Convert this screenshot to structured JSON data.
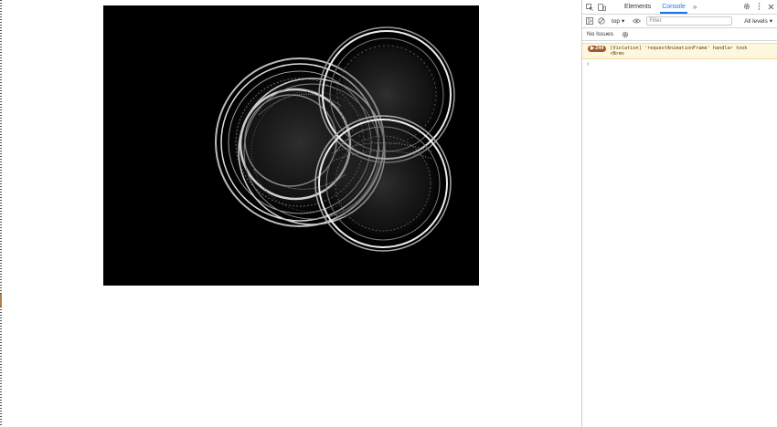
{
  "devtools": {
    "tabs": [
      {
        "label": "Elements"
      },
      {
        "label": "Console"
      }
    ],
    "more_tabs": "»",
    "toolbar": {
      "context": "top",
      "filter_placeholder": "Filter",
      "levels": "All levels"
    },
    "issues": "No Issues",
    "message": {
      "count": "244",
      "line1": "[Violation] 'requestAnimationFrame' handler took",
      "line2": "<N>ms"
    },
    "prompt": "›"
  },
  "colors": {
    "accent": "#1a73e8",
    "warning_bg": "#fef7e0",
    "badge": "#a05a2c",
    "canvas_bg": "#000000"
  },
  "icons": [
    "inspect-icon",
    "device-toggle-icon",
    "settings-gear-icon",
    "kebab-menu-icon",
    "close-icon",
    "sidebar-toggle-icon",
    "clear-console-icon",
    "eye-icon",
    "chevron-down-icon"
  ]
}
